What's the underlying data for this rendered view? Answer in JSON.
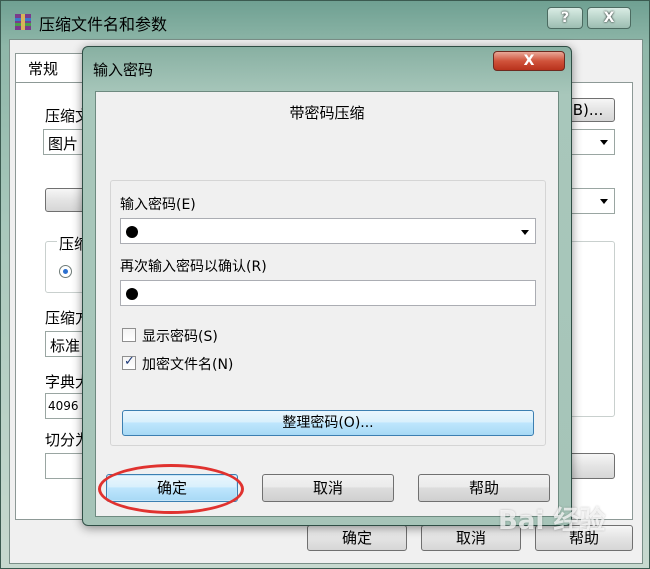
{
  "outer_window": {
    "title": "压缩文件名和参数",
    "help_button": "?",
    "close_button": "X",
    "tab_general": "常规",
    "partial_labels": {
      "archive_name": "压缩文",
      "archive_name_value": "图片",
      "archive_format": "压缩",
      "compression_method": "压缩方",
      "compression_value": "标准",
      "dictionary_size": "字典大",
      "dictionary_value": "4096",
      "split": "切分为"
    },
    "browse_button": "B)...",
    "ok_button": "确定",
    "cancel_button": "取消",
    "help_bottom_button": "帮助"
  },
  "password_dialog": {
    "title": "输入密码",
    "close_button": "X",
    "heading": "带密码压缩",
    "enter_password_label": "输入密码(E)",
    "enter_password_value": "●",
    "reenter_password_label": "再次输入密码以确认(R)",
    "reenter_password_value": "●",
    "show_password_label": "显示密码(S)",
    "show_password_checked": false,
    "encrypt_filenames_label": "加密文件名(N)",
    "encrypt_filenames_checked": true,
    "organize_button": "整理密码(O)...",
    "ok_button": "确定",
    "cancel_button": "取消",
    "help_button": "帮助"
  },
  "watermark": "Bai 经验",
  "colors": {
    "highlight_ring": "#e0322f",
    "focus_button": "#bee6fd",
    "window_frame": "#88b0a2"
  }
}
